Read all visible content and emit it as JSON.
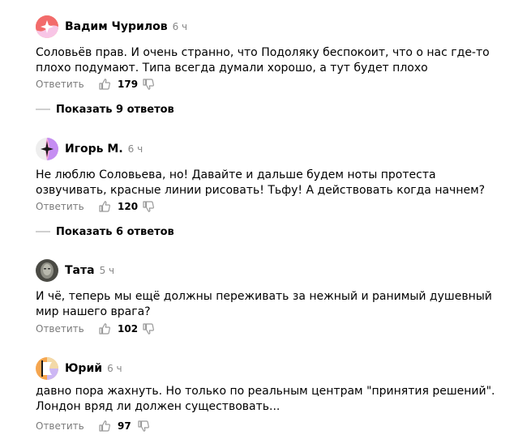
{
  "comments": [
    {
      "author": "Вадим Чурилов",
      "time": "6 ч",
      "text": "Соловьёв прав. И очень странно, что Подоляку беспокоит, что о нас где-то плохо подумают. Типа всегда думали хорошо, а тут будет плохо",
      "reply_label": "Ответить",
      "likes": "179",
      "show_replies": "Показать 9 ответов"
    },
    {
      "author": "Игорь М.",
      "time": "6 ч",
      "text": "Не люблю Соловьева, но! Давайте и дальше будем ноты протеста озвучивать, красные линии рисовать! Тьфу! А действовать когда начнем?",
      "reply_label": "Ответить",
      "likes": "120",
      "show_replies": "Показать 6 ответов"
    },
    {
      "author": "Тата",
      "time": "5 ч",
      "text": "И чё, теперь мы ещё должны переживать за нежный и ранимый душевный мир нашего врага?",
      "reply_label": "Ответить",
      "likes": "102"
    },
    {
      "author": "Юрий",
      "time": "6 ч",
      "text": "давно пора жахнуть. Но только по реальным центрам \"принятия решений\". Лондон вряд ли должен существовать...",
      "reply_label": "Ответить",
      "likes": "97"
    }
  ],
  "icons": {
    "like": "thumbs-up-icon",
    "dislike": "thumbs-down-icon"
  },
  "colors": {
    "muted": "#7a7a7a",
    "divider": "#cfcfcf",
    "avatar1": "#f4876b",
    "avatar2": "#b78cf0",
    "avatar4": "#f6a64f"
  }
}
